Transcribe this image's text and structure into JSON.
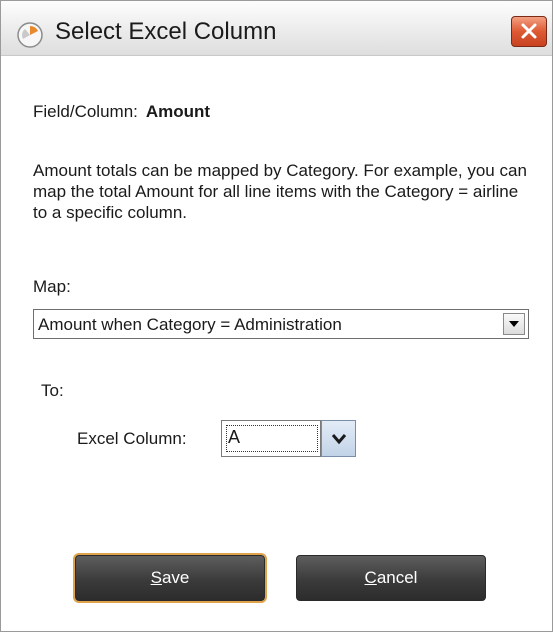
{
  "window": {
    "title": "Select Excel Column",
    "close_icon": "close-icon"
  },
  "field": {
    "label": "Field/Column:",
    "value": "Amount"
  },
  "description": "Amount totals can be mapped by Category. For example, you can map the total Amount for all line items with the Category = airline to a specific column.",
  "map": {
    "label": "Map:",
    "selected": "Amount when Category = Administration"
  },
  "to": {
    "label": "To:",
    "excel_column_label": "Excel Column:",
    "excel_column_value": "A"
  },
  "buttons": {
    "save": {
      "mnemonic": "S",
      "rest": "ave"
    },
    "cancel": {
      "mnemonic": "C",
      "rest": "ancel"
    }
  },
  "colors": {
    "close_button": "#dd5a33",
    "button_bg": "#3b3b3b",
    "default_focus": "#e0a24a"
  }
}
